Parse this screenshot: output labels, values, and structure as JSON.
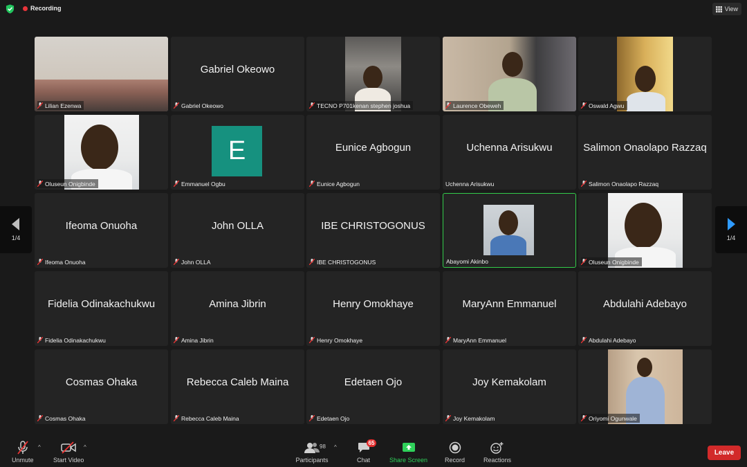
{
  "top": {
    "recording_label": "Recording",
    "view_label": "View"
  },
  "pager": {
    "left_label": "1/4",
    "right_label": "1/4"
  },
  "tiles": [
    {
      "name": "Lilian Ezenwa",
      "big": ""
    },
    {
      "name": "Gabriel Okeowo",
      "big": "Gabriel Okeowo"
    },
    {
      "name": "TECNO P701kenan stephen joshua",
      "big": ""
    },
    {
      "name": "Laurence Obeweh",
      "big": ""
    },
    {
      "name": "Oswald Agwu",
      "big": ""
    },
    {
      "name": "Oluseun Onigbinde",
      "big": ""
    },
    {
      "name": "Emmanuel Ogbu",
      "big": "",
      "avatar_letter": "E"
    },
    {
      "name": "Eunice Agbogun",
      "big": "Eunice Agbogun"
    },
    {
      "name": "Uchenna Arisukwu",
      "big": "Uchenna Arisukwu"
    },
    {
      "name": "Salimon Onaolapo Razzaq",
      "big": "Salimon Onaolapo Razzaq"
    },
    {
      "name": "Ifeoma Onuoha",
      "big": "Ifeoma Onuoha"
    },
    {
      "name": "John OLLA",
      "big": "John OLLA"
    },
    {
      "name": "IBE CHRISTOGONUS",
      "big": "IBE CHRISTOGONUS"
    },
    {
      "name": "Abayomi Akinbo",
      "big": ""
    },
    {
      "name": "Oluseun Onigbinde",
      "big": ""
    },
    {
      "name": "Fidelia Odinakachukwu",
      "big": "Fidelia Odinakachukwu"
    },
    {
      "name": "Amina Jibrin",
      "big": "Amina Jibrin"
    },
    {
      "name": "Henry Omokhaye",
      "big": "Henry Omokhaye"
    },
    {
      "name": "MaryAnn Emmanuel",
      "big": "MaryAnn Emmanuel"
    },
    {
      "name": "Abdulahi Adebayo",
      "big": "Abdulahi Adebayo"
    },
    {
      "name": "Cosmas Ohaka",
      "big": "Cosmas Ohaka"
    },
    {
      "name": "Rebecca Caleb Maina",
      "big": "Rebecca Caleb Maina"
    },
    {
      "name": "Edetaen Ojo",
      "big": "Edetaen Ojo"
    },
    {
      "name": "Joy Kemakolam",
      "big": "Joy Kemakolam"
    },
    {
      "name": "Oriyomi Ogunwale",
      "big": ""
    }
  ],
  "toolbar": {
    "unmute_label": "Unmute",
    "start_video_label": "Start Video",
    "participants_label": "Participants",
    "participants_count": "98",
    "chat_label": "Chat",
    "chat_badge": "65",
    "share_label": "Share Screen",
    "record_label": "Record",
    "reactions_label": "Reactions",
    "leave_label": "Leave"
  },
  "colors": {
    "active_speaker": "#33cc4a",
    "leave": "#d22a2a",
    "share": "#2fd15a",
    "recording_dot": "#e8343a",
    "avatar_bg": "#16917f"
  }
}
